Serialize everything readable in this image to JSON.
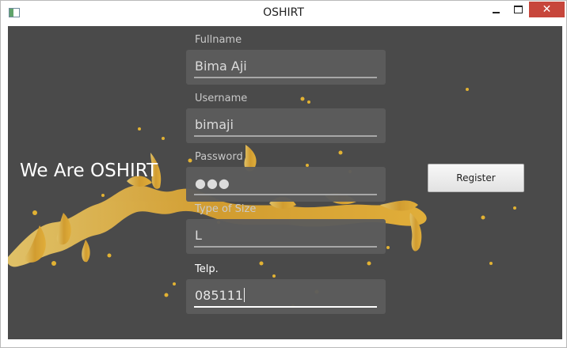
{
  "window": {
    "title": "OSHIRT",
    "close_glyph": "✕"
  },
  "brand": "We Are OSHIRT",
  "form": {
    "fields": [
      {
        "label": "Fullname",
        "value": "Bima Aji"
      },
      {
        "label": "Username",
        "value": "bimaji"
      },
      {
        "label": "Password",
        "value": "●●●"
      },
      {
        "label": "Type of Size",
        "value": "L"
      },
      {
        "label": "Telp.",
        "value": "085111"
      }
    ],
    "register_label": "Register"
  },
  "colors": {
    "background": "#4a4a4a",
    "splash": "#e0b23b",
    "close_button": "#c7463b"
  },
  "icons": {
    "app": "window-app-icon",
    "minimize": "minimize-icon",
    "maximize": "maximize-icon",
    "close": "close-icon"
  }
}
